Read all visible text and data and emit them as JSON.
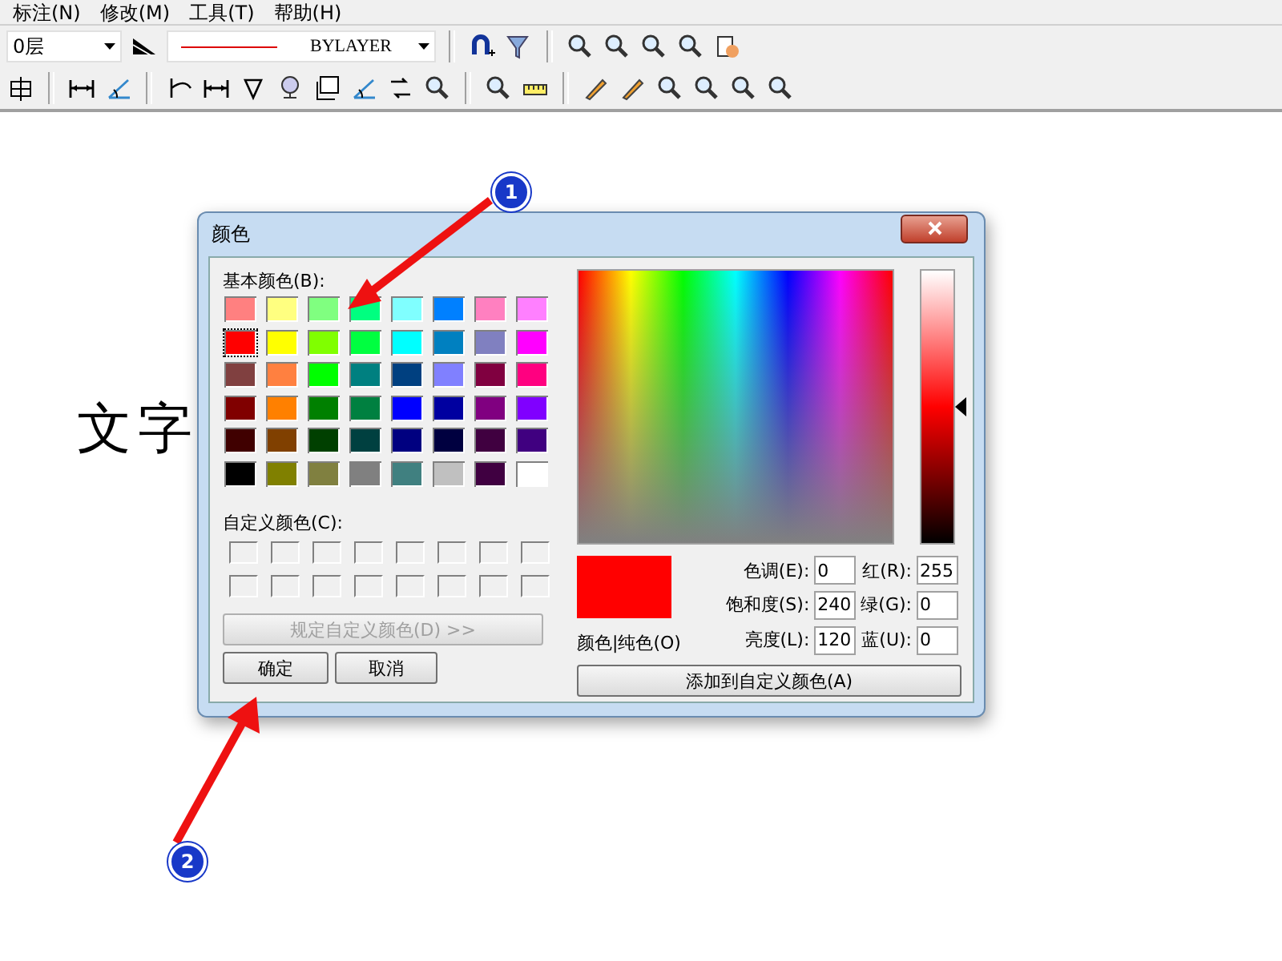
{
  "menu": [
    {
      "label": "标注(N)"
    },
    {
      "label": "修改(M)"
    },
    {
      "label": "工具(T)"
    },
    {
      "label": "帮助(H)"
    }
  ],
  "toolbar": {
    "layer_combo": {
      "value": "0层"
    },
    "linetype_combo": {
      "value": "BYLAYER"
    }
  },
  "canvas_text": "文字",
  "dialog": {
    "title": "颜色",
    "basic_colors_label": "基本颜色(B):",
    "basic_colors": [
      {
        "color": "#ff8080",
        "selected": false
      },
      {
        "color": "#ffff80",
        "selected": false
      },
      {
        "color": "#80ff80",
        "selected": false
      },
      {
        "color": "#00ff80",
        "selected": false
      },
      {
        "color": "#80ffff",
        "selected": false
      },
      {
        "color": "#0080ff",
        "selected": false
      },
      {
        "color": "#ff80c0",
        "selected": false
      },
      {
        "color": "#ff80ff",
        "selected": false
      },
      {
        "color": "#ff0000",
        "selected": true
      },
      {
        "color": "#ffff00",
        "selected": false
      },
      {
        "color": "#80ff00",
        "selected": false
      },
      {
        "color": "#00ff40",
        "selected": false
      },
      {
        "color": "#00ffff",
        "selected": false
      },
      {
        "color": "#0080c0",
        "selected": false
      },
      {
        "color": "#8080c0",
        "selected": false
      },
      {
        "color": "#ff00ff",
        "selected": false
      },
      {
        "color": "#804040",
        "selected": false
      },
      {
        "color": "#ff8040",
        "selected": false
      },
      {
        "color": "#00ff00",
        "selected": false
      },
      {
        "color": "#008080",
        "selected": false
      },
      {
        "color": "#004080",
        "selected": false
      },
      {
        "color": "#8080ff",
        "selected": false
      },
      {
        "color": "#800040",
        "selected": false
      },
      {
        "color": "#ff0080",
        "selected": false
      },
      {
        "color": "#800000",
        "selected": false
      },
      {
        "color": "#ff8000",
        "selected": false
      },
      {
        "color": "#008000",
        "selected": false
      },
      {
        "color": "#008040",
        "selected": false
      },
      {
        "color": "#0000ff",
        "selected": false
      },
      {
        "color": "#0000a0",
        "selected": false
      },
      {
        "color": "#800080",
        "selected": false
      },
      {
        "color": "#8000ff",
        "selected": false
      },
      {
        "color": "#400000",
        "selected": false
      },
      {
        "color": "#804000",
        "selected": false
      },
      {
        "color": "#004000",
        "selected": false
      },
      {
        "color": "#004040",
        "selected": false
      },
      {
        "color": "#000080",
        "selected": false
      },
      {
        "color": "#000040",
        "selected": false
      },
      {
        "color": "#400040",
        "selected": false
      },
      {
        "color": "#400080",
        "selected": false
      },
      {
        "color": "#000000",
        "selected": false
      },
      {
        "color": "#808000",
        "selected": false
      },
      {
        "color": "#808040",
        "selected": false
      },
      {
        "color": "#808080",
        "selected": false
      },
      {
        "color": "#408080",
        "selected": false
      },
      {
        "color": "#c0c0c0",
        "selected": false
      },
      {
        "color": "#400041",
        "selected": false
      },
      {
        "color": "#ffffff",
        "selected": false
      }
    ],
    "custom_colors_label": "自定义颜色(C):",
    "define_custom_button": {
      "label": "规定自定义颜色(D) >>",
      "disabled": true
    },
    "ok_button": {
      "label": "确定"
    },
    "cancel_button": {
      "label": "取消"
    },
    "luminance": {
      "level": 0.5
    },
    "preview": {
      "color": "#ff0000",
      "label": "颜色|纯色(O)"
    },
    "fields": [
      {
        "label": "色调(E):",
        "value": "0"
      },
      {
        "label": "红(R):",
        "value": "255"
      },
      {
        "label": "饱和度(S):",
        "value": "240"
      },
      {
        "label": "绿(G):",
        "value": "0"
      },
      {
        "label": "亮度(L):",
        "value": "120"
      },
      {
        "label": "蓝(U):",
        "value": "0"
      }
    ],
    "add_button": {
      "label": "添加到自定义颜色(A)"
    }
  },
  "annotations": [
    {
      "label": "1"
    },
    {
      "label": "2"
    }
  ]
}
